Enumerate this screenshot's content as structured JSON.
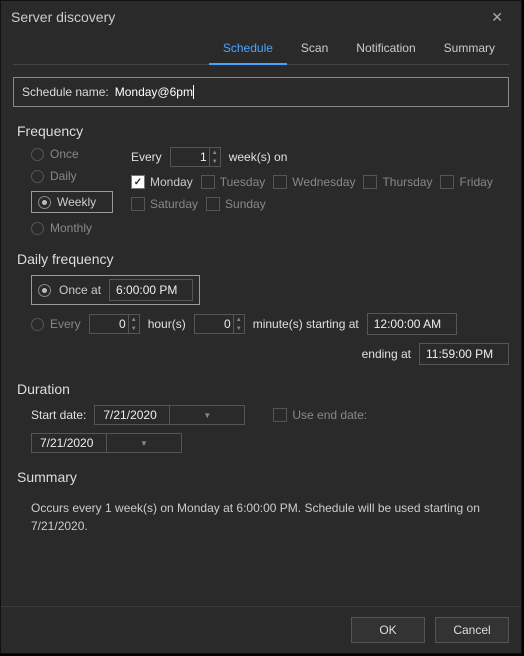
{
  "window": {
    "title": "Server discovery"
  },
  "tabs": {
    "schedule": "Schedule",
    "scan": "Scan",
    "notification": "Notification",
    "summary": "Summary",
    "active": "schedule"
  },
  "nameRow": {
    "label": "Schedule name:",
    "value": "Monday@6pm"
  },
  "frequency": {
    "title": "Frequency",
    "options": {
      "once": "Once",
      "daily": "Daily",
      "weekly": "Weekly",
      "monthly": "Monthly"
    },
    "selected": "weekly",
    "everyLabelPrefix": "Every",
    "everyValue": "1",
    "everyLabelSuffix": "week(s) on",
    "days": {
      "mon": "Monday",
      "tue": "Tuesday",
      "wed": "Wednesday",
      "thu": "Thursday",
      "fri": "Friday",
      "sat": "Saturday",
      "sun": "Sunday"
    },
    "daysChecked": {
      "mon": true,
      "tue": false,
      "wed": false,
      "thu": false,
      "fri": false,
      "sat": false,
      "sun": false
    }
  },
  "dailyFreq": {
    "title": "Daily frequency",
    "onceLabel": "Once at",
    "onceTime": "6:00:00 PM",
    "everyLabel": "Every",
    "everyHours": "0",
    "hoursLabel": "hour(s)",
    "everyMinutes": "0",
    "minutesLabel": "minute(s) starting at",
    "startTime": "12:00:00 AM",
    "endingLabel": "ending at",
    "endTime": "11:59:00 PM",
    "selected": "once"
  },
  "duration": {
    "title": "Duration",
    "startLabel": "Start date:",
    "startDate": "7/21/2020",
    "useEndLabel": "Use end date:",
    "useEndChecked": false,
    "endDate": "7/21/2020"
  },
  "summary": {
    "title": "Summary",
    "text": "Occurs every 1 week(s) on Monday at 6:00:00 PM. Schedule will be used starting on 7/21/2020."
  },
  "buttons": {
    "ok": "OK",
    "cancel": "Cancel"
  }
}
